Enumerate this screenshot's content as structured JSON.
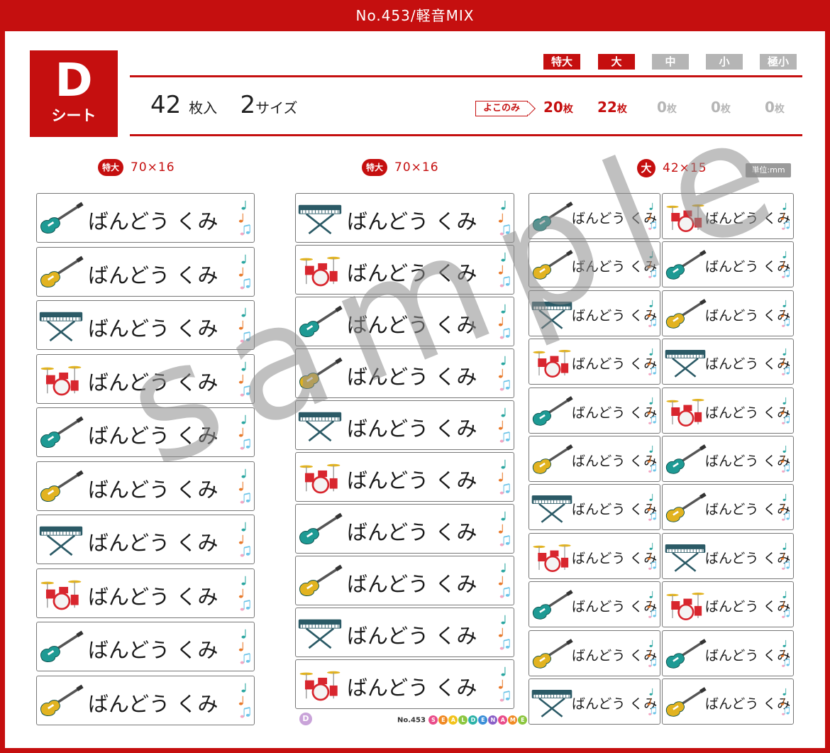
{
  "header": {
    "title": "No.453/軽音MIX"
  },
  "sheet": {
    "letter": "D",
    "label": "シート"
  },
  "sizes": [
    {
      "label": "特大",
      "active": true
    },
    {
      "label": "大",
      "active": true
    },
    {
      "label": "中",
      "active": false
    },
    {
      "label": "小",
      "active": false
    },
    {
      "label": "極小",
      "active": false
    }
  ],
  "count": {
    "sheets_num": "42",
    "sheets_unit": "枚入",
    "sizes_num": "2",
    "sizes_unit": "サイズ"
  },
  "yoko_label": "よこのみ",
  "quantities": [
    {
      "value": "20",
      "unit": "枚",
      "active": true
    },
    {
      "value": "22",
      "unit": "枚",
      "active": true
    },
    {
      "value": "0",
      "unit": "枚",
      "active": false
    },
    {
      "value": "0",
      "unit": "枚",
      "active": false
    },
    {
      "value": "0",
      "unit": "枚",
      "active": false
    }
  ],
  "columns": [
    {
      "size_badge": "特大",
      "dimension": "70×16"
    },
    {
      "size_badge": "特大",
      "dimension": "70×16"
    },
    {
      "size_badge": "大",
      "dimension": "42×15"
    }
  ],
  "unit_label": "単位:mm",
  "label_name": "ばんどう くみ",
  "col1_icons": [
    "guitar-teal",
    "guitar-yellow",
    "keyboard",
    "drums",
    "guitar-teal",
    "guitar-yellow",
    "keyboard",
    "drums",
    "guitar-teal",
    "guitar-yellow"
  ],
  "col2_icons": [
    "keyboard",
    "drums",
    "guitar-teal",
    "guitar-yellow",
    "keyboard",
    "drums",
    "guitar-teal",
    "guitar-yellow",
    "keyboard",
    "drums"
  ],
  "col3_icons": [
    "guitar-teal",
    "guitar-yellow",
    "keyboard",
    "drums",
    "guitar-teal",
    "guitar-yellow",
    "keyboard",
    "drums",
    "guitar-teal",
    "guitar-yellow",
    "keyboard"
  ],
  "col4_icons": [
    "drums",
    "guitar-teal",
    "guitar-yellow",
    "keyboard",
    "drums",
    "guitar-teal",
    "guitar-yellow",
    "keyboard",
    "drums",
    "guitar-teal",
    "guitar-yellow"
  ],
  "footer": {
    "sheet_letter": "D",
    "number": "No.453",
    "brand_letters": [
      "S",
      "E",
      "A",
      "L",
      "D",
      "E",
      "N",
      "A",
      "M",
      "E"
    ]
  },
  "watermark": "sample",
  "colors": {
    "brand_red": "#c50f0f",
    "inactive_gray": "#b5b5b5",
    "teal": "#1e9a94",
    "yellow": "#e2b320",
    "drum_red": "#d8262e",
    "keyboard_dark": "#2b5a66"
  }
}
